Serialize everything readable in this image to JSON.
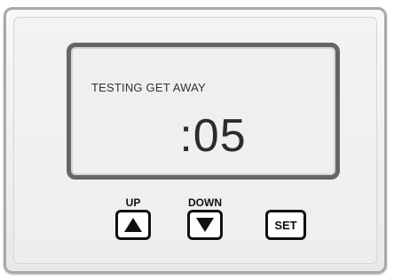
{
  "display": {
    "status_text": "TESTING GET AWAY",
    "countdown": ":05"
  },
  "buttons": {
    "up_label": "UP",
    "down_label": "DOWN",
    "set_label": "SET"
  },
  "icons": {
    "up": "up-arrow-icon",
    "down": "down-arrow-icon"
  },
  "colors": {
    "display_border": "#666666",
    "button_border": "#111111",
    "panel_border": "#a9a9a9"
  }
}
